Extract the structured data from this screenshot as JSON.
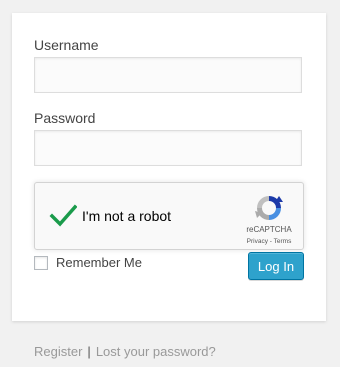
{
  "form": {
    "username_label": "Username",
    "username_value": "",
    "password_label": "Password",
    "password_value": "",
    "remember_label": "Remember Me",
    "remember_checked": false,
    "login_label": "Log In"
  },
  "recaptcha": {
    "label": "I'm not a robot",
    "brand": "reCAPTCHA",
    "terms": "Privacy - Terms",
    "checked": true,
    "check_color": "#1a9b4b"
  },
  "nav": {
    "register": "Register",
    "separator": "|",
    "lost_password": "Lost your password?"
  },
  "colors": {
    "accent": "#2ea2cc",
    "background": "#f1f1f1"
  }
}
